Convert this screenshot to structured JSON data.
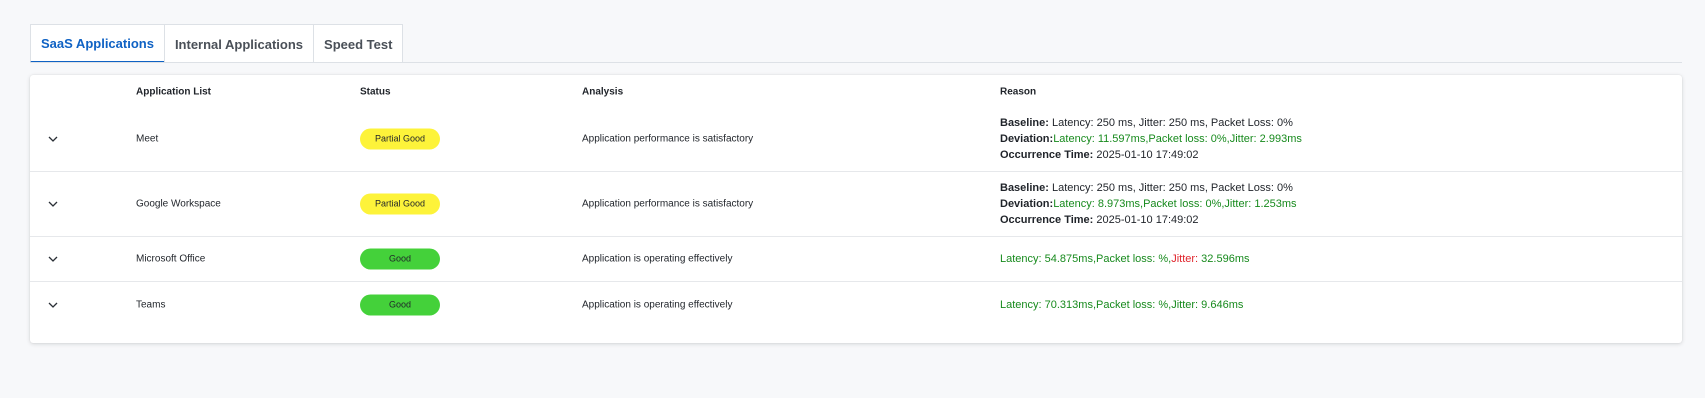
{
  "tabs": [
    {
      "label": "SaaS Applications",
      "active": true
    },
    {
      "label": "Internal Applications",
      "active": false
    },
    {
      "label": "Speed Test",
      "active": false
    }
  ],
  "table": {
    "headers": {
      "app": "Application List",
      "status": "Status",
      "analysis": "Analysis",
      "reason": "Reason"
    },
    "rows": [
      {
        "app": "Meet",
        "status": "Partial Good",
        "analysis": "Application performance is satisfactory",
        "baseline_label": "Baseline:",
        "baseline": " Latency: 250 ms, Jitter: 250 ms, Packet Loss: 0%",
        "deviation_label": "Deviation:",
        "dev_latency": "Latency: 11.597ms",
        "dev_sep1": ",",
        "dev_packet": "Packet loss: 0%",
        "dev_sep2": ",",
        "dev_jitter": "Jitter: 2.993ms",
        "occurrence_label": "Occurrence Time:",
        "occurrence": " 2025-01-10 17:49:02"
      },
      {
        "app": "Google Workspace",
        "status": "Partial Good",
        "analysis": "Application performance is satisfactory",
        "baseline_label": "Baseline:",
        "baseline": " Latency: 250 ms, Jitter: 250 ms, Packet Loss: 0%",
        "deviation_label": "Deviation:",
        "dev_latency": "Latency: 8.973ms",
        "dev_sep1": ",",
        "dev_packet": "Packet loss: 0%",
        "dev_sep2": ",",
        "dev_jitter": "Jitter: 1.253ms",
        "occurrence_label": "Occurrence Time:",
        "occurrence": " 2025-01-10 17:49:02"
      },
      {
        "app": "Microsoft Office",
        "status": "Good",
        "analysis": "Application is operating effectively",
        "latency": "Latency: 54.875ms",
        "sep1": ",",
        "packet": "Packet loss: %",
        "sep2": ",",
        "jitter_label": "Jitter:",
        "jitter_value": " 32.596ms"
      },
      {
        "app": "Teams",
        "status": "Good",
        "analysis": "Application is operating effectively",
        "latency": "Latency: 70.313ms",
        "sep1": ",",
        "packet": "Packet loss: %",
        "sep2": ",",
        "jitter_label": "Jitter:",
        "jitter_value": " 9.646ms"
      }
    ]
  },
  "colors": {
    "accent": "#0f62c4",
    "partial_good": "#fdf33a",
    "good": "#44d13a",
    "ok_text": "#178a1d",
    "bad_text": "#e0242c"
  }
}
